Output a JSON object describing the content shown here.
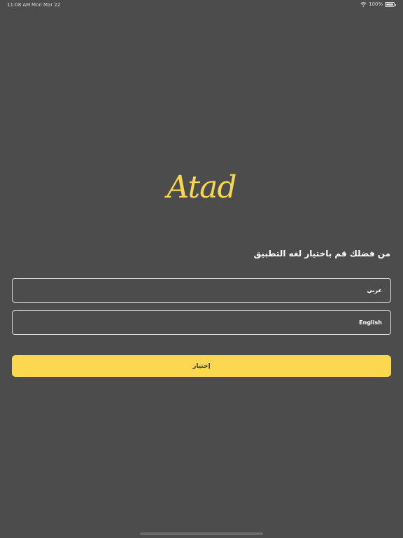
{
  "status_bar": {
    "time": "11:08 AM",
    "date": "Mon Mar 22",
    "battery": "100%",
    "battery_level": 1.0
  },
  "logo": {
    "text": "Atad"
  },
  "prompt": "من فضلك قم باختيار لغه التطبيق",
  "language_options": {
    "arabic": "عربي",
    "english": "English"
  },
  "select_button": "إختيار",
  "colors": {
    "background": "#4d4c4d",
    "accent": "#fbd84f",
    "logo": "#f7d750",
    "border": "#d8d8d8"
  }
}
